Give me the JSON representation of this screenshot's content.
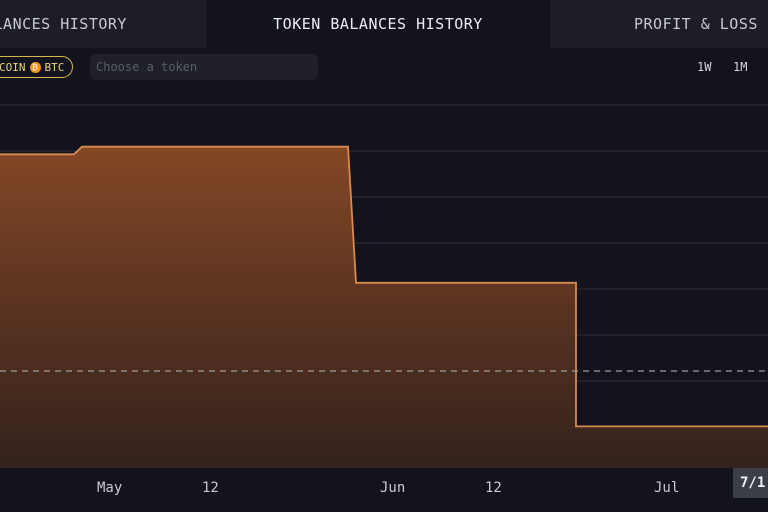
{
  "tabs": {
    "left": "ALANCES HISTORY",
    "middle": "TOKEN BALANCES HISTORY",
    "right": "PROFIT & LOSS"
  },
  "filter": {
    "pill_text": "COIN",
    "btc_label": "BTC",
    "btc_symbol": "₿",
    "token_placeholder": "Choose a token"
  },
  "ranges": [
    "1W",
    "1M"
  ],
  "date_badge": "7/1",
  "colors": {
    "background": "#12131c",
    "area_stroke": "#d98a4c",
    "area_fill_top": "#8a4a26",
    "pill_border": "#d6b94a",
    "btc": "#f2931b"
  },
  "chart_data": {
    "type": "area",
    "x_tick_labels": [
      "May",
      "12",
      "Jun",
      "12",
      "Jul"
    ],
    "y_tick_labels": [],
    "grid": true,
    "reference_line": "dashed",
    "series": [
      {
        "values": [
          0.83,
          0.83,
          0.85,
          0.85,
          0.85,
          0.49,
          0.49,
          0.49,
          0.11,
          0.11,
          0.11
        ]
      }
    ]
  }
}
